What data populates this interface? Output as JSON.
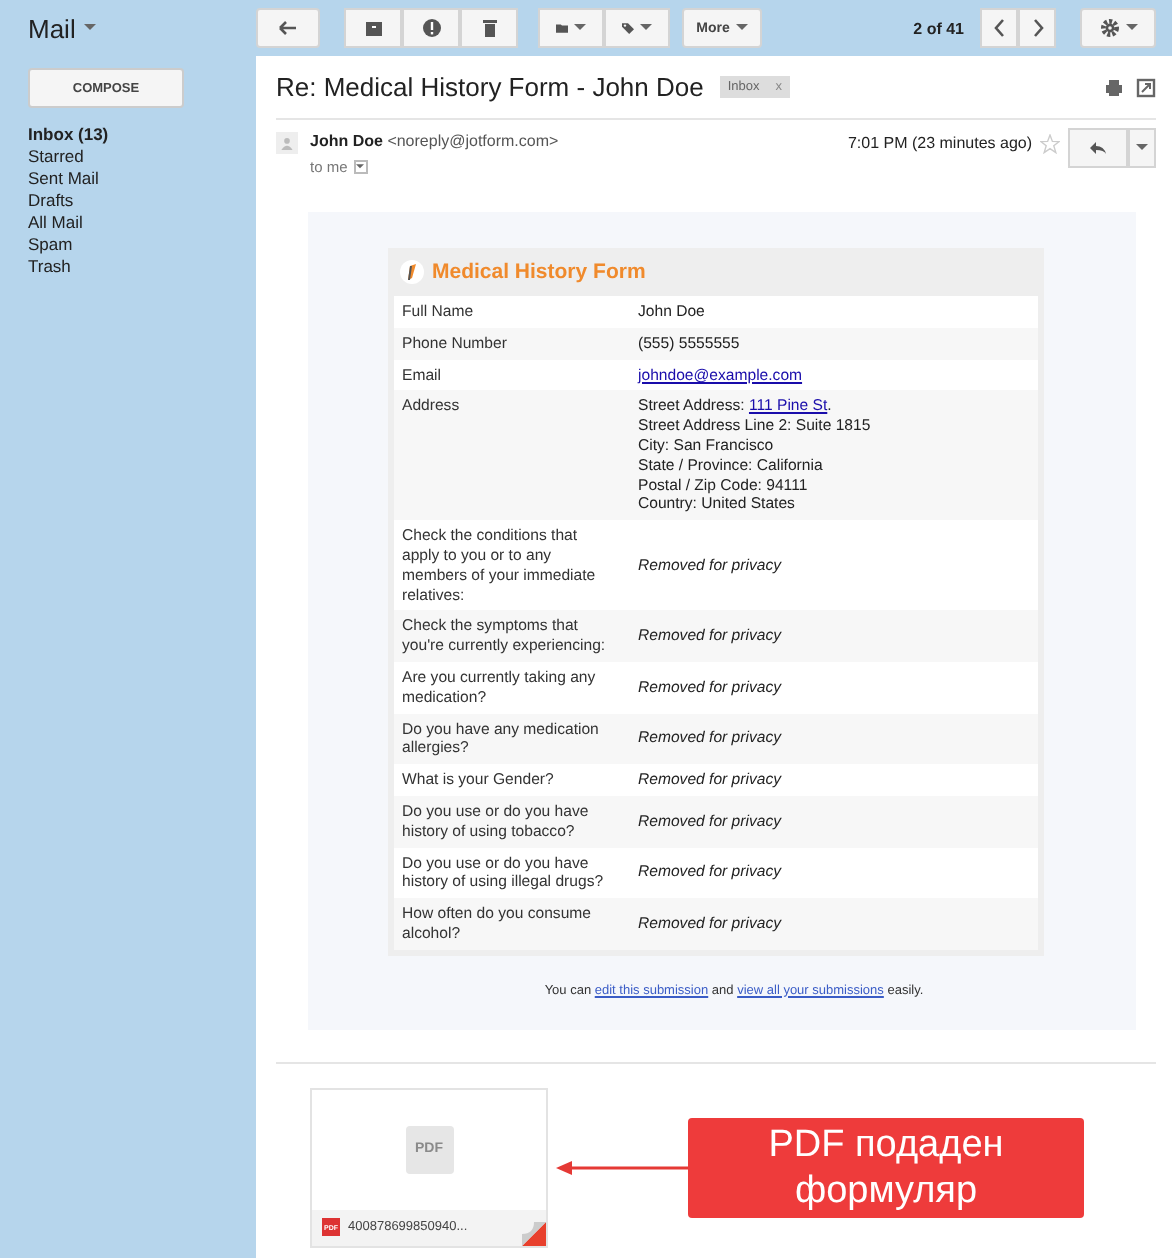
{
  "app_title": "Mail",
  "toolbar": {
    "more": "More",
    "pager": "2 of 41"
  },
  "compose": "COMPOSE",
  "folders": [
    {
      "label": "Inbox (13)",
      "selected": true
    },
    {
      "label": "Starred",
      "selected": false
    },
    {
      "label": "Sent Mail",
      "selected": false
    },
    {
      "label": "Drafts",
      "selected": false
    },
    {
      "label": "All Mail",
      "selected": false
    },
    {
      "label": "Spam",
      "selected": false
    },
    {
      "label": "Trash",
      "selected": false
    }
  ],
  "subject": "Re: Medical History Form - John Doe",
  "label_chip": {
    "text": "Inbox",
    "close": "x"
  },
  "message": {
    "sender": "John Doe",
    "address": "<noreply@jotform.com>",
    "to": "to me",
    "time": "7:01 PM (23 minutes ago)",
    "starred": false
  },
  "form": {
    "title": "Medical History Form",
    "rows": [
      {
        "kind": "text",
        "label": "Full Name",
        "value": "John Doe"
      },
      {
        "kind": "text",
        "label": "Phone Number",
        "value": "(555) 5555555"
      },
      {
        "kind": "link",
        "label": "Email",
        "value": "johndoe@example.com"
      },
      {
        "kind": "address",
        "label": "Address",
        "lines": [
          {
            "prefix": "Street Address: ",
            "link": "111 Pine St",
            "suffix": "."
          },
          {
            "prefix": "Street Address Line 2: Suite 1815"
          },
          {
            "prefix": "City: San Francisco"
          },
          {
            "prefix": "State / Province: California"
          },
          {
            "prefix": "Postal / Zip Code: 94111"
          },
          {
            "prefix": "Country: United States"
          }
        ]
      },
      {
        "kind": "private",
        "label": "Check the conditions that apply to you or to any members of your immediate relatives:",
        "value": "Removed for privacy"
      },
      {
        "kind": "private",
        "label": "Check the symptoms that you're currently experiencing:",
        "value": "Removed for privacy"
      },
      {
        "kind": "private",
        "label": "Are you currently taking any medication?",
        "value": "Removed for privacy"
      },
      {
        "kind": "private",
        "label": "Do you have any medication allergies?",
        "value": "Removed for privacy"
      },
      {
        "kind": "private",
        "label": "What is your Gender?",
        "value": "Removed for privacy"
      },
      {
        "kind": "private",
        "label": "Do you use or do you have history of using tobacco?",
        "value": "Removed for privacy"
      },
      {
        "kind": "private",
        "label": "Do you use or do you have history of using illegal drugs?",
        "value": "Removed for privacy"
      },
      {
        "kind": "private",
        "label": "How often do you consume alcohol?",
        "value": "Removed for privacy"
      }
    ]
  },
  "footer": [
    {
      "kind": "text",
      "text": "You can "
    },
    {
      "kind": "link",
      "text": "edit this submission"
    },
    {
      "kind": "text",
      "text": " and "
    },
    {
      "kind": "link",
      "text": "view all your submissions"
    },
    {
      "kind": "text",
      "text": " easily."
    }
  ],
  "attachment": {
    "thumb_label": "PDF",
    "badge": "PDF",
    "filename": "400878699850940..."
  },
  "callout": "PDF подаден формуляр"
}
